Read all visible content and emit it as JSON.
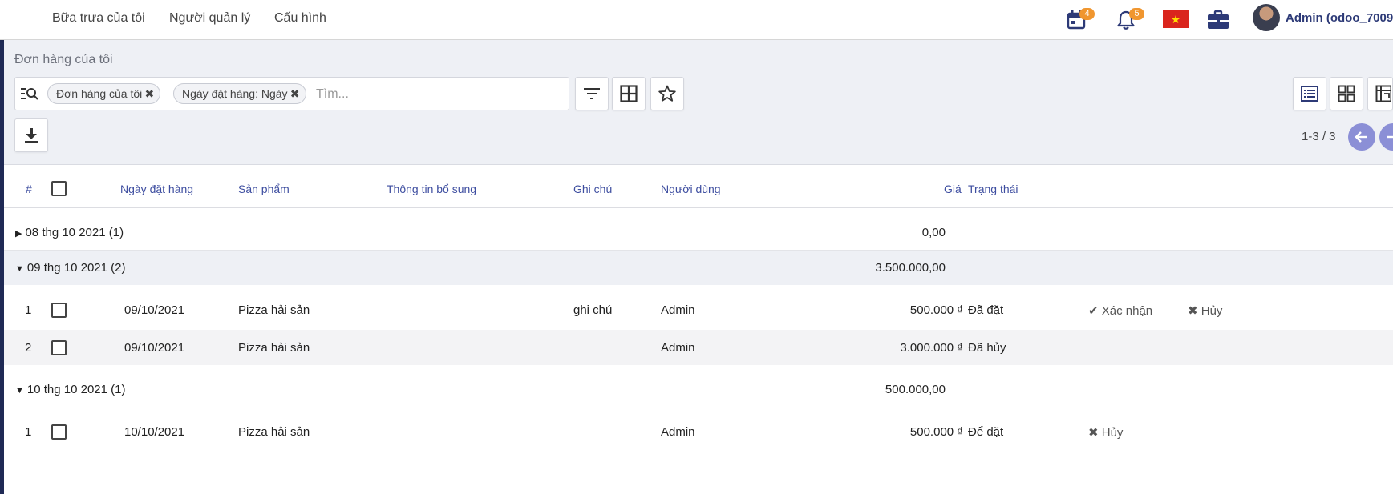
{
  "topnav": {
    "menu": [
      "Bữa trưa của tôi",
      "Người quản lý",
      "Cấu hình"
    ],
    "activity_count": "4",
    "notification_count": "5",
    "user_name": "Admin (odoo_7009"
  },
  "control": {
    "breadcrumb": "Đơn hàng của tôi",
    "facets": [
      "Đơn hàng của tôi",
      "Ngày đặt hàng: Ngày"
    ],
    "search_placeholder": "Tìm...",
    "pager": "1-3 / 3"
  },
  "list": {
    "headers": {
      "num": "#",
      "date": "Ngày đặt hàng",
      "product": "Sản phẩm",
      "extra": "Thông tin bổ sung",
      "note": "Ghi chú",
      "user": "Người dùng",
      "price": "Giá",
      "state": "Trạng thái"
    },
    "groups": [
      {
        "label": "08 thg 10 2021 (1)",
        "total": "0,00",
        "expanded": false,
        "rows": []
      },
      {
        "label": "09 thg 10 2021 (2)",
        "total": "3.500.000,00",
        "expanded": true,
        "rows": [
          {
            "num": "1",
            "date": "09/10/2021",
            "product": "Pizza hải sản",
            "note": "ghi chú",
            "user": "Admin",
            "price": "500.000 ₫",
            "state": "Đã đặt",
            "confirm": "Xác nhận",
            "cancel": "Hủy"
          },
          {
            "num": "2",
            "date": "09/10/2021",
            "product": "Pizza hải sản",
            "note": "",
            "user": "Admin",
            "price": "3.000.000 ₫",
            "state": "Đã hủy",
            "confirm": "",
            "cancel": ""
          }
        ]
      },
      {
        "label": "10 thg 10 2021 (1)",
        "total": "500.000,00",
        "expanded": true,
        "rows": [
          {
            "num": "1",
            "date": "10/10/2021",
            "product": "Pizza hải sản",
            "note": "",
            "user": "Admin",
            "price": "500.000 ₫",
            "state": "Để đặt",
            "confirm": "",
            "cancel": "Hủy"
          }
        ]
      }
    ]
  },
  "colors": {
    "accent": "#3e4ea0",
    "badge": "#f0962f",
    "pager_button": "#8b8fd6",
    "control_bg": "#eef0f5"
  }
}
